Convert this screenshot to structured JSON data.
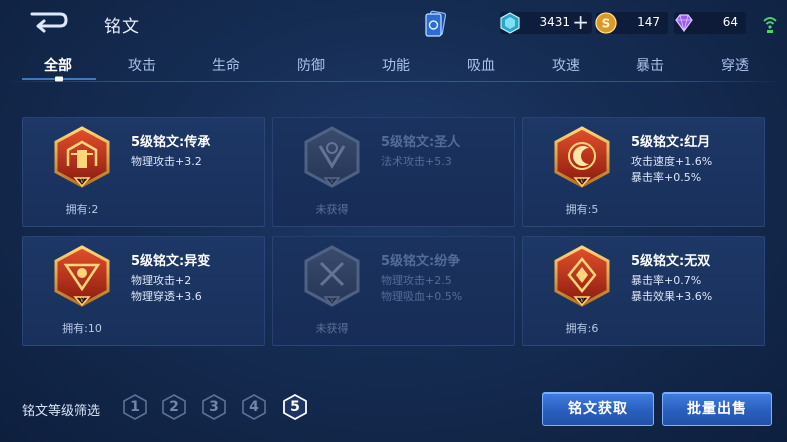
{
  "header": {
    "title": "铭文",
    "resources": [
      {
        "icon": "diamond-icon",
        "value": "3431"
      },
      {
        "icon": "gold-coin-icon",
        "value": "147"
      },
      {
        "icon": "purple-gem-icon",
        "value": "64"
      }
    ]
  },
  "tabs": [
    "全部",
    "攻击",
    "生命",
    "防御",
    "功能",
    "吸血",
    "攻速",
    "暴击",
    "穿透"
  ],
  "active_tab": "全部",
  "cards": [
    {
      "name": "5级铭文:传承",
      "stats": [
        "物理攻击+3.2",
        ""
      ],
      "owned": "拥有:2",
      "locked": false
    },
    {
      "name": "5级铭文:圣人",
      "stats": [
        "法术攻击+5.3",
        ""
      ],
      "owned": "未获得",
      "locked": true
    },
    {
      "name": "5级铭文:红月",
      "stats": [
        "攻击速度+1.6%",
        "暴击率+0.5%"
      ],
      "owned": "拥有:5",
      "locked": false
    },
    {
      "name": "5级铭文:异变",
      "stats": [
        "物理攻击+2",
        "物理穿透+3.6"
      ],
      "owned": "拥有:10",
      "locked": false
    },
    {
      "name": "5级铭文:纷争",
      "stats": [
        "物理攻击+2.5",
        "物理吸血+0.5%"
      ],
      "owned": "未获得",
      "locked": true
    },
    {
      "name": "5级铭文:无双",
      "stats": [
        "暴击率+0.7%",
        "暴击效果+3.6%"
      ],
      "owned": "拥有:6",
      "locked": false
    }
  ],
  "emblem_numeral": "V",
  "footer": {
    "filter_label": "铭文等级筛选",
    "levels": [
      "1",
      "2",
      "3",
      "4",
      "5"
    ],
    "active_level": "5",
    "obtain_button": "铭文获取",
    "sell_button": "批量出售"
  },
  "colors": {
    "accent": "#3f7ee0",
    "gold": "#e8b04a",
    "emblem_red": "#c0321c",
    "text_muted": "#a8c1ea"
  }
}
